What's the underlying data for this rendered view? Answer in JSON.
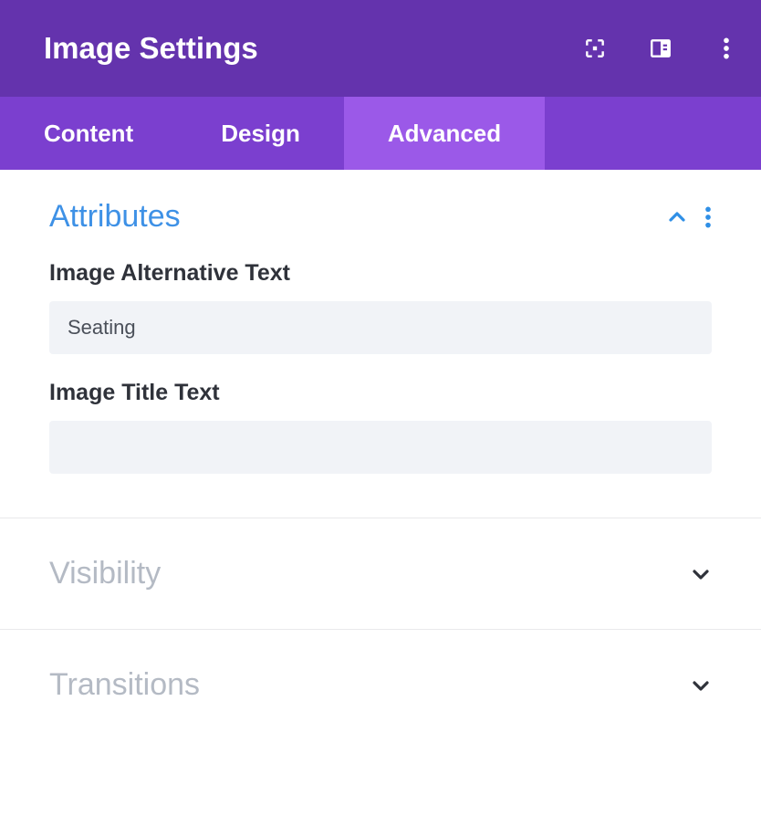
{
  "header": {
    "title": "Image Settings"
  },
  "tabs": {
    "content": "Content",
    "design": "Design",
    "advanced": "Advanced",
    "active": "advanced"
  },
  "sections": {
    "attributes": {
      "title": "Attributes",
      "expanded": true,
      "fields": {
        "alt": {
          "label": "Image Alternative Text",
          "value": "Seating"
        },
        "title": {
          "label": "Image Title Text",
          "value": ""
        }
      }
    },
    "visibility": {
      "title": "Visibility",
      "expanded": false
    },
    "transitions": {
      "title": "Transitions",
      "expanded": false
    }
  }
}
